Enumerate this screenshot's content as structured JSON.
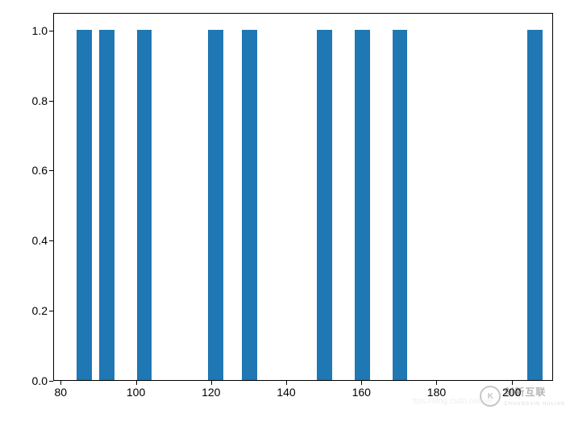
{
  "chart_data": {
    "type": "bar",
    "x": [
      86,
      92,
      102,
      121,
      130,
      150,
      160,
      170,
      206
    ],
    "values": [
      1.0,
      1.0,
      1.0,
      1.0,
      1.0,
      1.0,
      1.0,
      1.0,
      1.0
    ],
    "xlim": [
      78,
      211
    ],
    "ylim": [
      0.0,
      1.05
    ],
    "xticks": [
      80,
      100,
      120,
      140,
      160,
      180,
      200
    ],
    "yticks": [
      0.0,
      0.2,
      0.4,
      0.6,
      0.8,
      1.0
    ],
    "bar_color": "#1f77b4",
    "title": "",
    "xlabel": "",
    "ylabel": ""
  },
  "watermark": {
    "brand": "创新互联",
    "sub": "CHUANGXIN HULIAN",
    "faded": "ttps://blog.csdn.net/we"
  }
}
